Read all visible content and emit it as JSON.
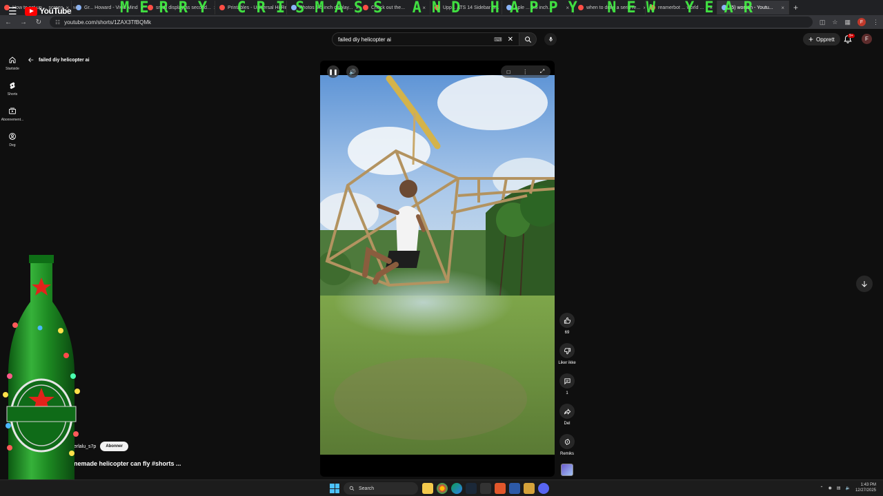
{
  "browser": {
    "tabs": [
      {
        "title": "How to set up ... screen"
      },
      {
        "title": "Gr... Howard - Vivid Mind"
      },
      {
        "title": "small display as second..."
      },
      {
        "title": "Printables - Universal Hi-Res"
      },
      {
        "title": "Photos 5.5 inch display..."
      },
      {
        "title": "Check out the..."
      },
      {
        "title": "Upp... ATS 14 Sidebar S..."
      },
      {
        "title": "Aple ... 5.5 inch..."
      },
      {
        "title": "when to draw a seris re..."
      },
      {
        "title": "reamerbot ... world ..."
      },
      {
        "title": "(5) woman - Youtu..."
      }
    ],
    "active_tab_index": 10,
    "banner_text": "MERRY CRISMASS AND HAPPY NEW YEAR",
    "url": "youtube.com/shorts/1ZAX3TfBQMk"
  },
  "youtube": {
    "logo_text": "YouTube",
    "country_code": "NO",
    "search_query": "failed diy helicopter ai",
    "create_label": "Opprett",
    "notification_count": "9+",
    "avatar_initial": "F",
    "sidebar": [
      {
        "label": "Startside",
        "icon": "home-icon"
      },
      {
        "label": "Shorts",
        "icon": "shorts-icon"
      },
      {
        "label": "Abonnement...",
        "icon": "subscriptions-icon"
      },
      {
        "label": "Deg",
        "icon": "you-icon"
      }
    ],
    "back_label": "failed diy helicopter ai",
    "short": {
      "channel": "erlalu_s7p",
      "subscribe_label": "Abonner",
      "title": "nemade helicopter can fly #shorts ...",
      "likes": "69",
      "dislike_label": "Liker ikke",
      "comments": "1",
      "share_label": "Del",
      "remix_label": "Remiks"
    }
  },
  "taskbar": {
    "search_placeholder": "Search",
    "time": "1:43 PM",
    "date": "12/27/2025"
  },
  "colors": {
    "banner_green": "#46ff46",
    "yt_red": "#ff0000",
    "page_bg": "#0f0f0f"
  }
}
